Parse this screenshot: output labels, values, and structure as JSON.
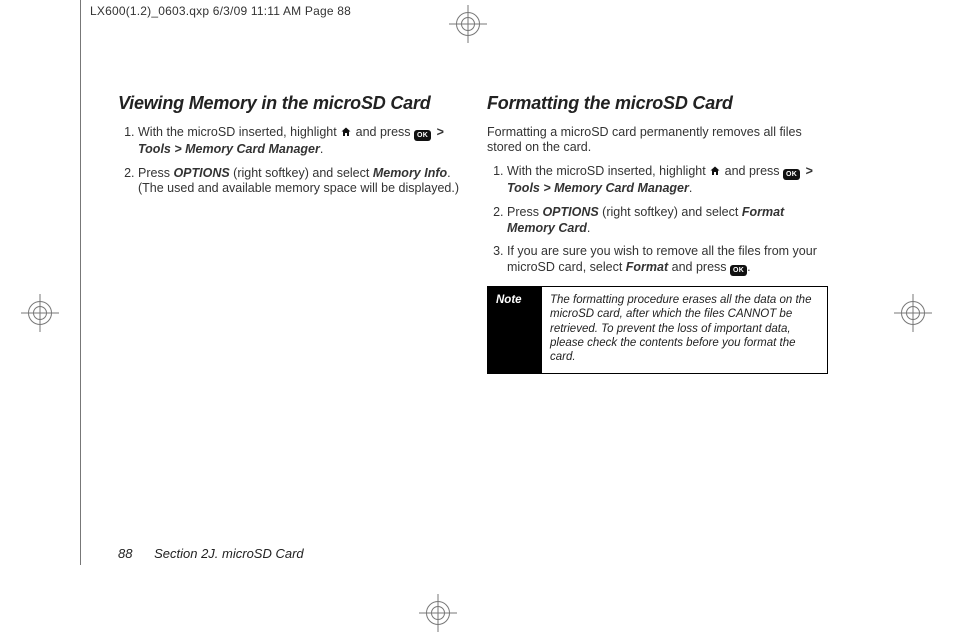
{
  "slug": "LX600(1.2)_0603.qxp  6/3/09  11:11 AM  Page 88",
  "left": {
    "heading": "Viewing Memory in the microSD Card",
    "steps": [
      {
        "pre": "With the microSD inserted, highlight ",
        "mid": " and press ",
        "path": "Tools > Memory Card Manager",
        "end": "."
      },
      {
        "pre": "Press ",
        "opt": "OPTIONS",
        "mid": " (right softkey) and select ",
        "sel": "Memory Info",
        "end": ". (The used and available memory space will be displayed.)"
      }
    ]
  },
  "right": {
    "heading": "Formatting the microSD Card",
    "intro": "Formatting a microSD card permanently removes all files stored on the card.",
    "steps": [
      {
        "pre": "With the microSD inserted, highlight ",
        "mid": " and press ",
        "path": "Tools > Memory Card Manager",
        "end": "."
      },
      {
        "pre": "Press ",
        "opt": "OPTIONS",
        "mid": " (right softkey) and select ",
        "sel": "Format Memory Card",
        "end": "."
      },
      {
        "pre": "If you are sure you wish to remove all the files from your microSD card, select ",
        "sel": "Format",
        "mid": " and press ",
        "end": "."
      }
    ],
    "note_label": "Note",
    "note_text": "The formatting procedure erases all the data on the microSD card, after which the files CANNOT be retrieved. To prevent the loss of important data, please check the contents before you format the card."
  },
  "footer": {
    "pageno": "88",
    "section": "Section 2J. microSD Card"
  },
  "icons": {
    "ok_label": "MENU OK"
  }
}
